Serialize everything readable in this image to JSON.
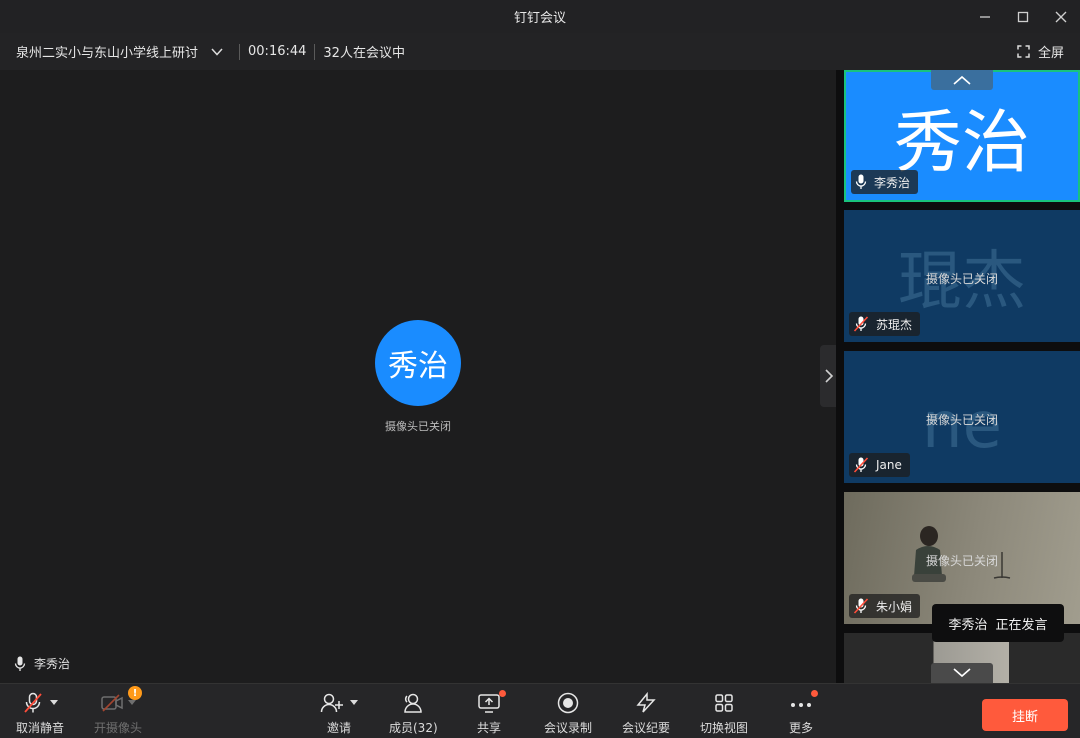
{
  "window": {
    "title": "钉钉会议"
  },
  "meeting": {
    "name": "泉州二实小与东山小学线上研讨",
    "timer": "00:16:44",
    "attendees": "32人在会议中",
    "fullscreen_label": "全屏"
  },
  "stage": {
    "avatar_text": "秀治",
    "camera_status": "摄像头已关闭",
    "speaker_name": "李秀治"
  },
  "participants": [
    {
      "name": "李秀治",
      "big_text": "秀治",
      "camera_status": "",
      "muted": false,
      "bg": "#1a8cff",
      "active": true
    },
    {
      "name": "苏琨杰",
      "big_text": "琨杰",
      "camera_status": "摄像头已关闭",
      "muted": true,
      "bg": "#0f3a63",
      "active": false
    },
    {
      "name": "Jane",
      "big_text": "ne",
      "camera_status": "摄像头已关闭",
      "muted": true,
      "bg": "#0f3a63",
      "active": false
    },
    {
      "name": "朱小娟",
      "big_text": "",
      "camera_status": "摄像头已关闭",
      "muted": true,
      "bg": "#7d7a6b",
      "active": false
    }
  ],
  "toast": {
    "name": "李秀治",
    "status": "正在发言"
  },
  "toolbar": {
    "unmute": "取消静音",
    "camera": "开摄像头",
    "invite": "邀请",
    "members": "成员(32)",
    "share": "共享",
    "record": "会议录制",
    "minutes": "会议纪要",
    "switch_view": "切换视图",
    "more": "更多",
    "hangup": "挂断"
  },
  "colors": {
    "accent": "#1a8cff",
    "hangup": "#ff5a3c",
    "active_border": "#19c37d"
  }
}
